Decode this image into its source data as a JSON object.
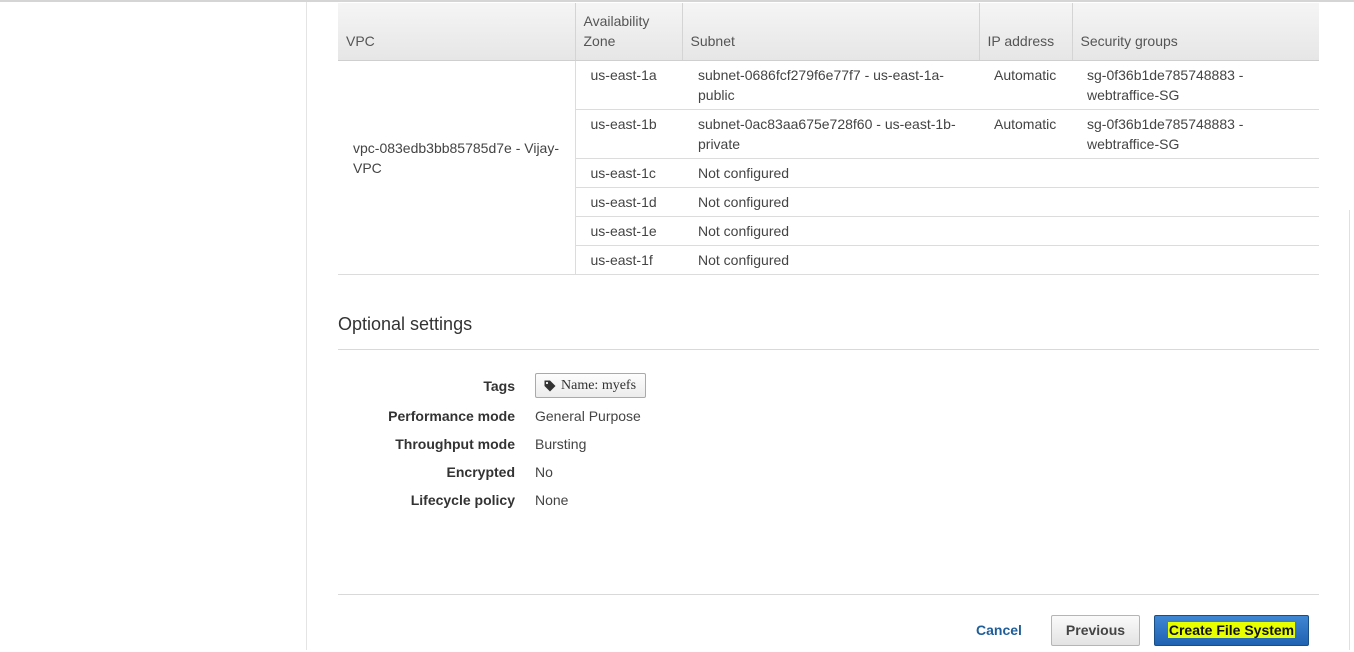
{
  "table": {
    "headers": {
      "vpc": "VPC",
      "az_line1": "Availability",
      "az_line2": "Zone",
      "subnet": "Subnet",
      "ip": "IP address",
      "sg": "Security groups"
    },
    "vpc_line1": "vpc-083edb3bb85785d7e - Vijay-",
    "vpc_line2": "VPC",
    "rows": [
      {
        "az": "us-east-1a",
        "subnet_line1": "subnet-0686fcf279f6e77f7 - us-east-1a-",
        "subnet_line2": "public",
        "ip": "Automatic",
        "sg_line1": "sg-0f36b1de785748883 -",
        "sg_line2": "webtraffice-SG"
      },
      {
        "az": "us-east-1b",
        "subnet_line1": "subnet-0ac83aa675e728f60 - us-east-1b-",
        "subnet_line2": "private",
        "ip": "Automatic",
        "sg_line1": "sg-0f36b1de785748883 -",
        "sg_line2": "webtraffice-SG"
      },
      {
        "az": "us-east-1c",
        "subnet_line1": "Not configured",
        "subnet_line2": "",
        "ip": "",
        "sg_line1": "",
        "sg_line2": ""
      },
      {
        "az": "us-east-1d",
        "subnet_line1": "Not configured",
        "subnet_line2": "",
        "ip": "",
        "sg_line1": "",
        "sg_line2": ""
      },
      {
        "az": "us-east-1e",
        "subnet_line1": "Not configured",
        "subnet_line2": "",
        "ip": "",
        "sg_line1": "",
        "sg_line2": ""
      },
      {
        "az": "us-east-1f",
        "subnet_line1": "Not configured",
        "subnet_line2": "",
        "ip": "",
        "sg_line1": "",
        "sg_line2": ""
      }
    ]
  },
  "optional": {
    "title": "Optional settings",
    "tags_label": "Tags",
    "tag_value": "Name: myefs",
    "tag_icon": "tag-icon",
    "performance_label": "Performance mode",
    "performance_value": "General Purpose",
    "throughput_label": "Throughput mode",
    "throughput_value": "Bursting",
    "encrypted_label": "Encrypted",
    "encrypted_value": "No",
    "lifecycle_label": "Lifecycle policy",
    "lifecycle_value": "None"
  },
  "footer": {
    "cancel_label": "Cancel",
    "previous_label": "Previous",
    "create_label": "Create File System"
  },
  "colors": {
    "primary_button": "#1f62b1",
    "highlight": "#e8ff00",
    "link": "#1f5e99"
  }
}
